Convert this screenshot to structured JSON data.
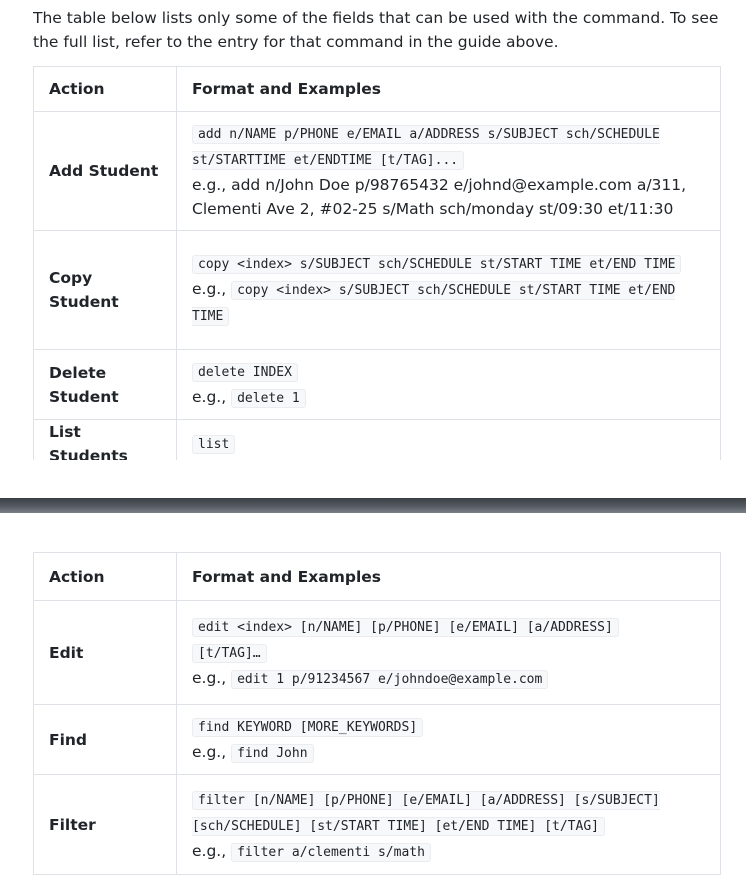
{
  "intro": "The table below lists only some of the fields that can be used with the command. To see the full list, refer to the entry for that command in the guide above.",
  "table1": {
    "headers": [
      "Action",
      "Format and Examples"
    ],
    "rows": [
      {
        "action": "Add Student",
        "format": "add n/NAME p/PHONE e/EMAIL a/ADDRESS s/SUBJECT sch/SCHEDULE st/STARTTIME et/ENDTIME [t/TAG]...",
        "eg_prefix": "e.g., ",
        "example": "add n/John Doe p/98765432 e/johnd@example.com a/311, Clementi Ave 2, #02-25 s/Math sch/monday st/09:30 et/11:30"
      },
      {
        "action": "Copy Student",
        "format": "copy <index> s/SUBJECT sch/SCHEDULE st/START TIME et/END TIME",
        "eg_prefix": "e.g., ",
        "example": "copy <index> s/SUBJECT sch/SCHEDULE st/START TIME et/END TIME"
      },
      {
        "action": "Delete Student",
        "format": "delete INDEX",
        "eg_prefix": "e.g., ",
        "example": "delete 1"
      },
      {
        "action": "List Students",
        "format": "list"
      }
    ]
  },
  "table2": {
    "headers": [
      "Action",
      "Format and Examples"
    ],
    "rows": [
      {
        "action": "Edit",
        "format": "edit <index> [n/NAME] [p/PHONE] [e/EMAIL] [a/ADDRESS]",
        "format_tail": "[t/TAG]…",
        "eg_prefix": "e.g., ",
        "example": "edit 1 p/91234567 e/johndoe@example.com"
      },
      {
        "action": "Find",
        "format": "find KEYWORD [MORE_KEYWORDS]",
        "eg_prefix": "e.g., ",
        "example": "find John"
      },
      {
        "action": "Filter",
        "format": "filter [n/NAME] [p/PHONE] [e/EMAIL] [a/ADDRESS] [s/SUBJECT] [sch/SCHEDULE] [st/START TIME] [et/END TIME] [t/TAG]",
        "eg_prefix": "e.g., ",
        "example": "filter a/clementi s/math"
      }
    ]
  }
}
